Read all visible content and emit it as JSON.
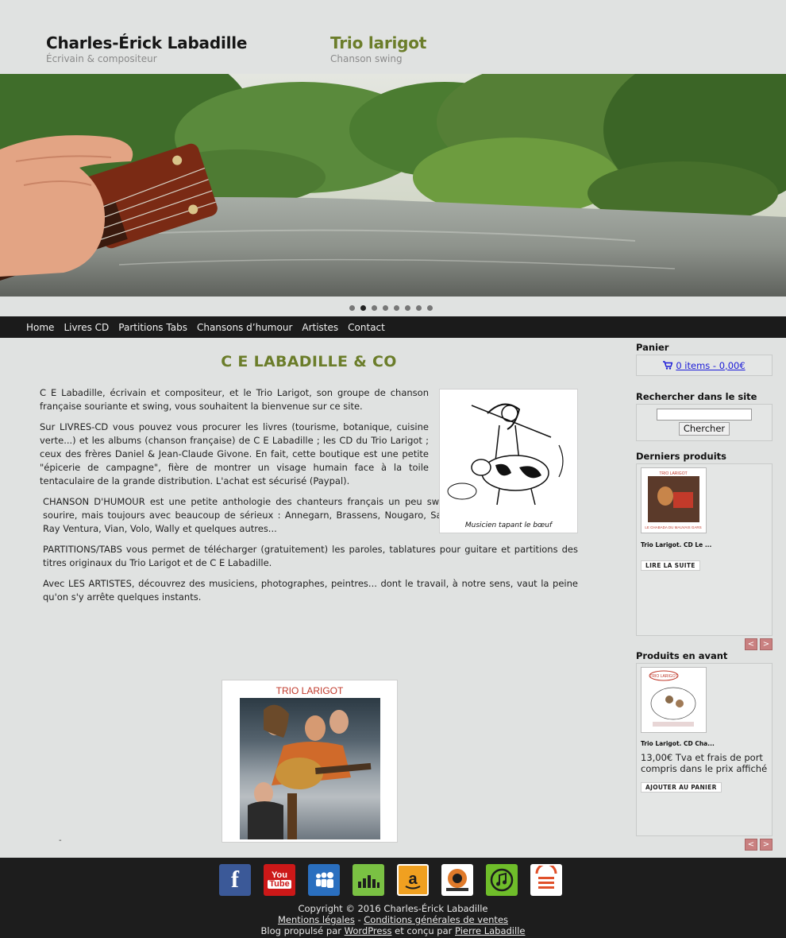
{
  "header": {
    "brand1": {
      "title": "Charles-Érick Labadille",
      "subtitle": "Écrivain & compositeur"
    },
    "brand2": {
      "title": "Trio larigot",
      "subtitle": "Chanson swing"
    }
  },
  "slider": {
    "total_dots": 8,
    "active_dot": 2
  },
  "nav": {
    "items": [
      "Home",
      "Livres CD",
      "Partitions Tabs",
      "Chansons d’humour",
      "Artistes",
      "Contact"
    ]
  },
  "main": {
    "title": "C E LABADILLE & CO",
    "paragraphs": [
      "C E Labadille, écrivain et compositeur, et le Trio Larigot, son groupe de chanson française souriante et swing, vous souhaitent la bienvenue sur ce site.",
      "Sur LIVRES-CD vous pouvez vous procurer les livres (tourisme, botanique, cuisine verte...) et les albums (chanson française) de C E Labadille ;  les CD du Trio Larigot ; ceux des frères Daniel & Jean-Claude Givone. En fait, cette boutique est une petite \"épicerie de campagne\", fière de montrer un visage humain face à la toile tentaculaire de la grande distribution. L'achat est sécurisé (Paypal).",
      "CHANSON D'HUMOUR est une petite anthologie des chanteurs français un peu swing qui souhaitent nous faire sourire, mais toujours avec beaucoup de sérieux : Annegarn, Brassens, Nougaro, Salvador, Sanseverino, Vassiliu, Ray Ventura, Vian, Volo, Wally et quelques autres...",
      "PARTITIONS/TABS vous permet de télécharger (gratuitement) les paroles, tablatures pour guitare et partitions des titres originaux du Trio Larigot et de C E Labadille.",
      "Avec LES ARTISTES, découvrez des musiciens, photographes, peintres... dont le travail, à notre sens, vaut la peine qu'on s'y arrête quelques instants."
    ],
    "cartoon_caption": "Musicien tapant le bœuf",
    "album_title": "TRIO LARIGOT",
    "dash": "-"
  },
  "sidebar": {
    "cart": {
      "title": "Panier",
      "summary": "0 items - 0,00€"
    },
    "search": {
      "title": "Rechercher dans le site",
      "button": "Chercher",
      "value": ""
    },
    "latest": {
      "title": "Derniers produits",
      "product_name": "Trio Larigot. CD Le ...",
      "button": "LIRE LA SUITE"
    },
    "featured": {
      "title": "Produits en avant",
      "product_name": "Trio Larigot. CD Cha...",
      "price": "13,00€ Tva et frais de port compris dans le prix affiché",
      "button": "AJOUTER AU PANIER"
    },
    "prev": "<",
    "next": ">"
  },
  "footer": {
    "icons": [
      "facebook-icon",
      "youtube-icon",
      "myspace-icon",
      "deezer-icon",
      "amazon-icon",
      "dansezvous-icon",
      "itunes-icon",
      "centre-chanson-icon"
    ],
    "copyright": "Copyright © 2016 Charles-Érick Labadille",
    "legal": "Mentions légales",
    "separator": " - ",
    "cgv": "Conditions générales de ventes",
    "powered_prefix": "Blog propulsé par ",
    "wordpress": "WordPress",
    "designed": " et conçu par ",
    "designer": "Pierre Labadille"
  }
}
